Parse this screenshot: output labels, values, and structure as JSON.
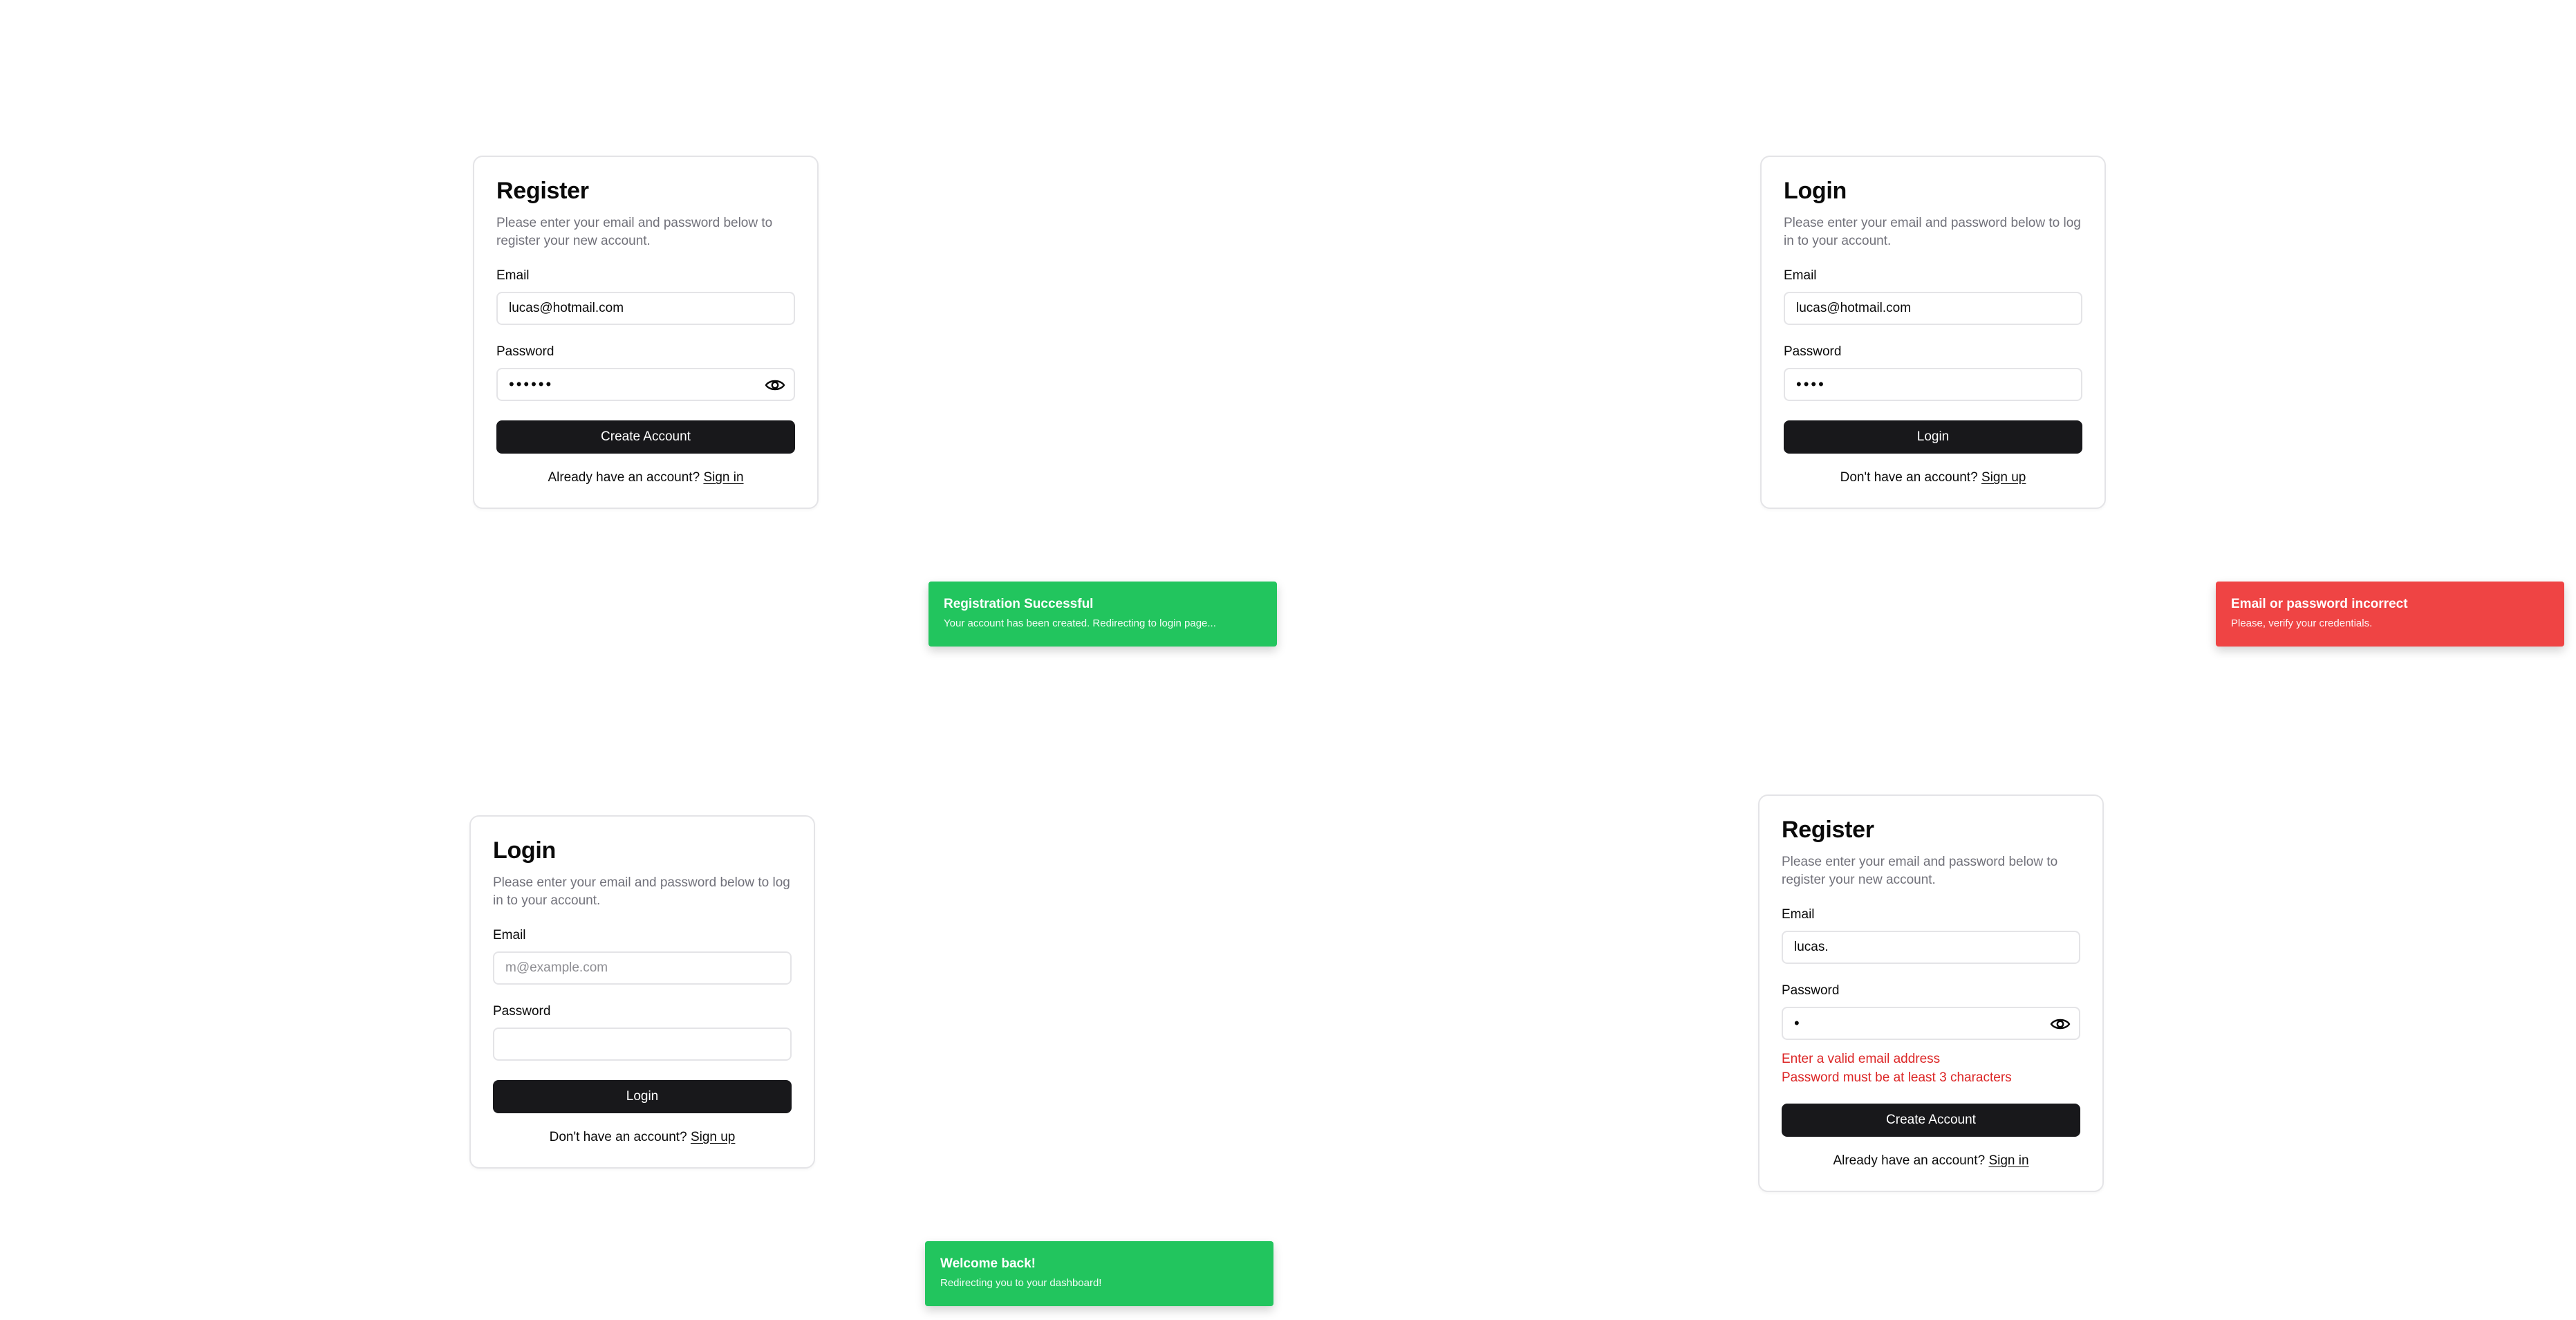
{
  "colors": {
    "success": "#22c55e",
    "error": "#ef4444",
    "primary_button": "#18181b"
  },
  "panels": [
    {
      "title": "Register",
      "description": "Please enter your email and password below to register your new account.",
      "email_label": "Email",
      "email_value": "lucas@hotmail.com",
      "password_label": "Password",
      "password_value": "••••••",
      "button_label": "Create Account",
      "footer_text": "Already have an account?",
      "footer_link": "Sign in",
      "toast": {
        "title": "Registration Successful",
        "message": "Your account has been created. Redirecting to login page..."
      }
    },
    {
      "title": "Login",
      "description": "Please enter your email and password below to log in to your account.",
      "email_label": "Email",
      "email_value": "lucas@hotmail.com",
      "password_label": "Password",
      "password_value": "••••",
      "button_label": "Login",
      "footer_text": "Don't have an account?",
      "footer_link": "Sign up",
      "toast": {
        "title": "Email or password incorrect",
        "message": "Please, verify your credentials."
      }
    },
    {
      "title": "Login",
      "description": "Please enter your email and password below to log in to your account.",
      "email_label": "Email",
      "email_placeholder": "m@example.com",
      "password_label": "Password",
      "button_label": "Login",
      "footer_text": "Don't have an account?",
      "footer_link": "Sign up",
      "toast": {
        "title": "Welcome back!",
        "message": "Redirecting you to your dashboard!"
      }
    },
    {
      "title": "Register",
      "description": "Please enter your email and password below to register your new account.",
      "email_label": "Email",
      "email_value": "lucas.",
      "password_label": "Password",
      "password_value": "•",
      "errors": [
        "Enter a valid email address",
        "Password must be at least 3 characters"
      ],
      "button_label": "Create Account",
      "footer_text": "Already have an account?",
      "footer_link": "Sign in"
    }
  ]
}
